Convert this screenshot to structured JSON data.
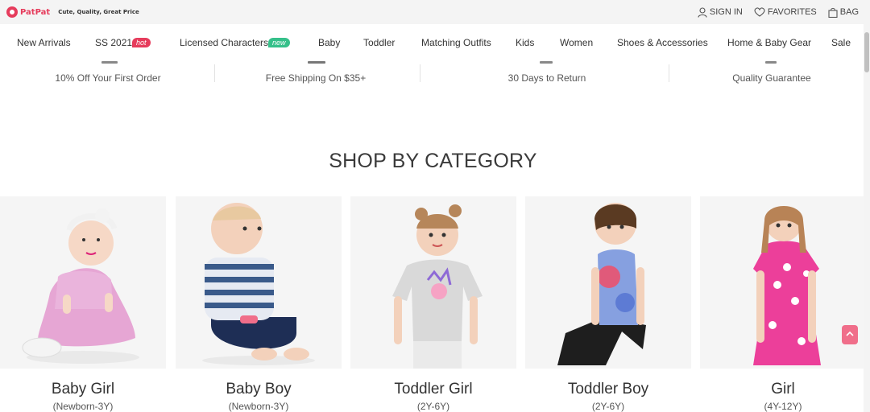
{
  "header": {
    "logo_text": "PatPat",
    "tagline": "Cute, Quality, Great Price",
    "sign_in": "SIGN IN",
    "favorites": "FAVORITES",
    "bag": "BAG"
  },
  "nav": {
    "items": [
      {
        "label": "New Arrivals"
      },
      {
        "label": "SS 2021",
        "badge": "hot"
      },
      {
        "label": "Licensed Characters",
        "badge": "new"
      },
      {
        "label": "Baby"
      },
      {
        "label": "Toddler"
      },
      {
        "label": "Matching Outfits"
      },
      {
        "label": "Kids"
      },
      {
        "label": "Women"
      },
      {
        "label": "Shoes & Accessories"
      },
      {
        "label": "Home & Baby Gear"
      },
      {
        "label": "Sale"
      }
    ]
  },
  "benefits": [
    {
      "label": "10% Off Your First Order"
    },
    {
      "label": "Free Shipping On $35+"
    },
    {
      "label": "30 Days to Return"
    },
    {
      "label": "Quality Guarantee"
    }
  ],
  "section": {
    "title": "SHOP BY CATEGORY"
  },
  "categories": [
    {
      "name": "Baby Girl",
      "age": "(Newborn-3Y)"
    },
    {
      "name": "Baby Boy",
      "age": "(Newborn-3Y)"
    },
    {
      "name": "Toddler Girl",
      "age": "(2Y-6Y)"
    },
    {
      "name": "Toddler Boy",
      "age": "(2Y-6Y)"
    },
    {
      "name": "Girl",
      "age": "(4Y-12Y)"
    }
  ],
  "colors": {
    "brand": "#e63c5c",
    "badge_hot": "#e63c5c",
    "badge_new": "#35c08a",
    "topbar_bg": "#f4f4f4",
    "card_bg": "#f5f5f5"
  },
  "icons": [
    "patpat-logo-icon",
    "user-icon",
    "heart-icon",
    "bag-icon"
  ]
}
